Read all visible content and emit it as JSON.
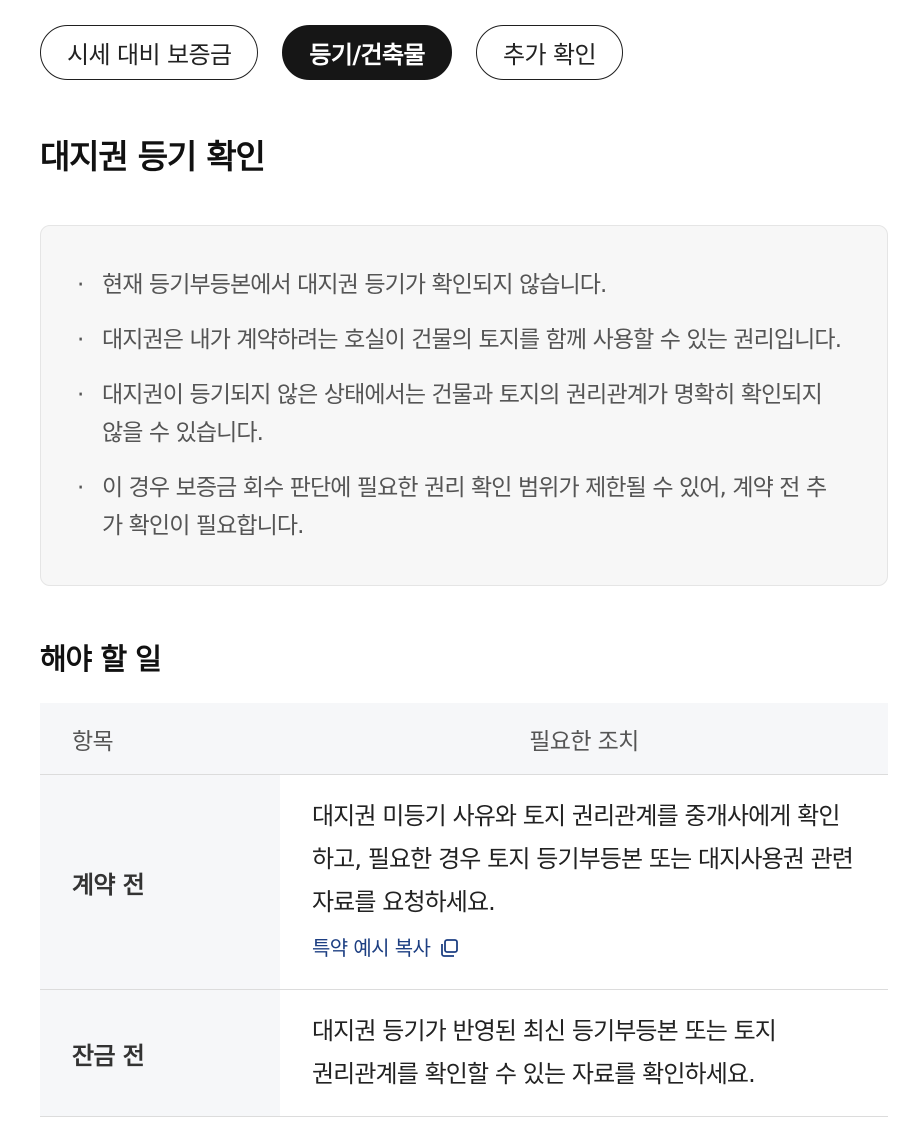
{
  "tabs": [
    {
      "label": "시세 대비 보증금",
      "active": false
    },
    {
      "label": "등기/건축물",
      "active": true
    },
    {
      "label": "추가 확인",
      "active": false
    }
  ],
  "section": {
    "title": "대지권 등기 확인",
    "items": [
      "현재 등기부등본에서 대지권 등기가 확인되지 않습니다.",
      "대지권은 내가 계약하려는 호실이 건물의 토지를 함께 사용할 수 있는 권리입니다.",
      "대지권이 등기되지 않은 상태에서는 건물과 토지의 권리관계가 명확히 확인되지 않을 수 있습니다.",
      "이 경우 보증금 회수 판단에 필요한 권리 확인 범위가 제한될 수 있어, 계약 전 추가 확인이 필요합니다."
    ]
  },
  "todo": {
    "title": "해야 할 일",
    "headers": {
      "item": "항목",
      "action": "필요한 조치"
    },
    "rows": [
      {
        "item": "계약 전",
        "action": "대지권 미등기 사유와 토지 권리관계를 중개사에게 확인하고, 필요한 경우 토지 등기부등본 또는 대지사용권 관련 자료를 요청하세요.",
        "link": "특약 예시 복사"
      },
      {
        "item": "잔금 전",
        "action": "대지권 등기가 반영된 최신 등기부등본 또는 토지 권리관계를 확인할 수 있는 자료를 확인하세요."
      }
    ]
  },
  "icons": {
    "copy": "copy-icon",
    "bullet": "·"
  },
  "colors": {
    "active_tab": "#161616",
    "link": "#1d3f82",
    "panel": "#f7f7f7"
  }
}
